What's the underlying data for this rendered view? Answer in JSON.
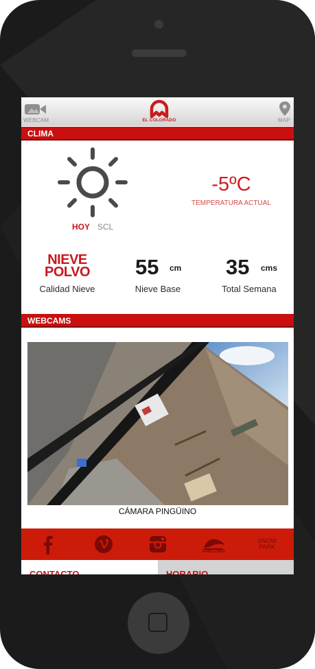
{
  "header": {
    "webcam_label": "WEBCAM",
    "map_label": "MAP",
    "logo_text": "EL COLORADO"
  },
  "clima": {
    "section_title": "CLIMA",
    "temperature": "-5ºC",
    "temperature_label": "TEMPERATURA ACTUAL",
    "tab_hoy": "HOY",
    "tab_scl": "SCL",
    "snow_quality_line1": "NIEVE",
    "snow_quality_line2": "POLVO",
    "snow_quality_label": "Calidad Nieve",
    "base_value": "55",
    "base_unit": "cm",
    "base_label": "Nieve Base",
    "week_value": "35",
    "week_unit": "cms",
    "week_label": "Total Semana"
  },
  "webcams": {
    "section_title": "WEBCAMS",
    "camera_caption": "CÁMARA PINGÜINO"
  },
  "social": {
    "farellones_label": "FARELLONES",
    "snowpark_line1": "SNOW",
    "snowpark_line2": "PARK"
  },
  "footer": {
    "contacto": "CONTACTO",
    "horario": "HORARIO"
  },
  "colors": {
    "brand_red": "#c90f0f",
    "phone_body": "#1b1b1b"
  }
}
